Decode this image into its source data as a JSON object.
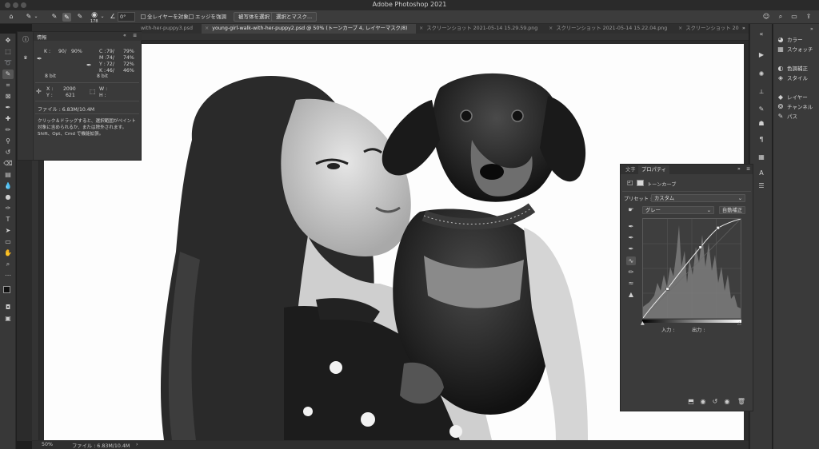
{
  "app": {
    "title": "Adobe Photoshop 2021"
  },
  "options_bar": {
    "size_value": "178",
    "angle_value": "0°",
    "sample_all_layers": "全レイヤーを対象",
    "enhance_edge": "エッジを強調",
    "select_subject": "被写体を選択",
    "select_and_mask": "選択とマスク..."
  },
  "tabs": [
    {
      "label": "with-her-puppy3.psd"
    },
    {
      "label": "young-girl-walk-with-her-puppy2.psd @ 50% (トーンカーブ 4, レイヤーマスク/8)",
      "active": true
    },
    {
      "label": "スクリーンショット 2021-05-14 15.29.59.png"
    },
    {
      "label": "スクリーンショット 2021-05-14 15.22.04.png"
    },
    {
      "label": "スクリーンショット 20"
    }
  ],
  "info_panel": {
    "title": "情報",
    "k_label": "K :",
    "k_value": "90/",
    "k_value2": "90%",
    "c_label": "C :",
    "c_value": "79/",
    "c_value2": "79%",
    "m_label": "M :",
    "m_value": "74/",
    "m_value2": "74%",
    "y_label": "Y :",
    "y_value": "72/",
    "y_value2": "72%",
    "k2_label": "K :",
    "k2_value": "46/",
    "k2_value2": "46%",
    "bit_left": "8 bit",
    "bit_right": "8 bit",
    "x_label": "X :",
    "x_value": "2090",
    "y2_label": "Y :",
    "y2_value": "621",
    "w_label": "W :",
    "h_label": "H :",
    "file_info": "ファイル : 6.83M/10.4M",
    "hint_line1": "クリック＆ドラッグすると、選択範囲がペイント",
    "hint_line2": "対象に含められるか、または除外されます。",
    "hint_line3": "Shift、Opt、Cmd で機能拡張。"
  },
  "dock": {
    "color": "カラー",
    "swatches": "スウォッチ",
    "adjustments": "色調補正",
    "styles": "スタイル",
    "layers": "レイヤー",
    "channels": "チャンネル",
    "paths": "パス"
  },
  "properties": {
    "tab_character": "文字",
    "tab_properties": "プロパティ",
    "adjustment_name": "トーンカーブ",
    "preset_label": "プリセット :",
    "preset_value": "カスタム",
    "channel_value": "グレー",
    "auto_button": "自動補正",
    "input_label": "入力 :",
    "output_label": "出力 :"
  },
  "status": {
    "zoom": "50%",
    "file": "ファイル : 6.83M/10.4M"
  },
  "curve_points": [
    [
      0,
      0
    ],
    [
      64,
      75
    ],
    [
      150,
      182
    ],
    [
      196,
      232
    ],
    [
      255,
      255
    ]
  ],
  "colors": {
    "accent": "#2f72ff",
    "panel": "#3a3a3a",
    "canvas": "#fdfdfd"
  }
}
